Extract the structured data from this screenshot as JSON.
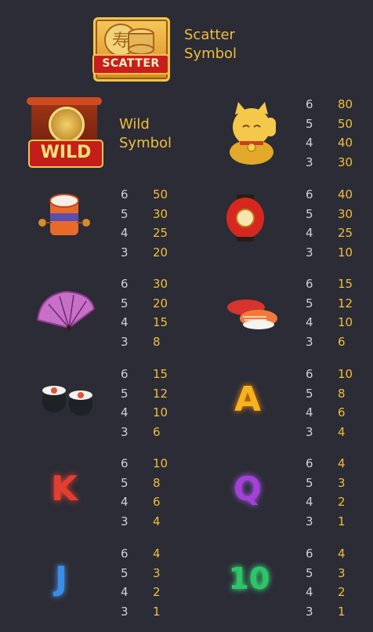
{
  "scatter": {
    "ribbon": "SCATTER",
    "label_line1": "Scatter",
    "label_line2": "Symbol"
  },
  "wild": {
    "ribbon": "WILD",
    "label_line1": "Wild",
    "label_line2": "Symbol"
  },
  "symbols": [
    {
      "icon": "lucky-cat-icon",
      "pays": [
        {
          "count": "6",
          "value": "80"
        },
        {
          "count": "5",
          "value": "50"
        },
        {
          "count": "4",
          "value": "40"
        },
        {
          "count": "3",
          "value": "30"
        }
      ]
    },
    {
      "icon": "drum-icon",
      "pays": [
        {
          "count": "6",
          "value": "50"
        },
        {
          "count": "5",
          "value": "30"
        },
        {
          "count": "4",
          "value": "25"
        },
        {
          "count": "3",
          "value": "20"
        }
      ]
    },
    {
      "icon": "lantern-icon",
      "pays": [
        {
          "count": "6",
          "value": "40"
        },
        {
          "count": "5",
          "value": "30"
        },
        {
          "count": "4",
          "value": "25"
        },
        {
          "count": "3",
          "value": "10"
        }
      ]
    },
    {
      "icon": "fan-icon",
      "pays": [
        {
          "count": "6",
          "value": "30"
        },
        {
          "count": "5",
          "value": "20"
        },
        {
          "count": "4",
          "value": "15"
        },
        {
          "count": "3",
          "value": "8"
        }
      ]
    },
    {
      "icon": "sushi-nigiri-icon",
      "pays": [
        {
          "count": "6",
          "value": "15"
        },
        {
          "count": "5",
          "value": "12"
        },
        {
          "count": "4",
          "value": "10"
        },
        {
          "count": "3",
          "value": "6"
        }
      ]
    },
    {
      "icon": "sushi-roll-icon",
      "pays": [
        {
          "count": "6",
          "value": "15"
        },
        {
          "count": "5",
          "value": "12"
        },
        {
          "count": "4",
          "value": "10"
        },
        {
          "count": "3",
          "value": "6"
        }
      ]
    },
    {
      "icon": "letter-a-icon",
      "pays": [
        {
          "count": "6",
          "value": "10"
        },
        {
          "count": "5",
          "value": "8"
        },
        {
          "count": "4",
          "value": "6"
        },
        {
          "count": "3",
          "value": "4"
        }
      ]
    },
    {
      "icon": "letter-k-icon",
      "pays": [
        {
          "count": "6",
          "value": "10"
        },
        {
          "count": "5",
          "value": "8"
        },
        {
          "count": "4",
          "value": "6"
        },
        {
          "count": "3",
          "value": "4"
        }
      ]
    },
    {
      "icon": "letter-q-icon",
      "pays": [
        {
          "count": "6",
          "value": "4"
        },
        {
          "count": "5",
          "value": "3"
        },
        {
          "count": "4",
          "value": "2"
        },
        {
          "count": "3",
          "value": "1"
        }
      ]
    },
    {
      "icon": "letter-j-icon",
      "pays": [
        {
          "count": "6",
          "value": "4"
        },
        {
          "count": "5",
          "value": "3"
        },
        {
          "count": "4",
          "value": "2"
        },
        {
          "count": "3",
          "value": "1"
        }
      ]
    },
    {
      "icon": "number-10-icon",
      "pays": [
        {
          "count": "6",
          "value": "4"
        },
        {
          "count": "5",
          "value": "3"
        },
        {
          "count": "4",
          "value": "2"
        },
        {
          "count": "3",
          "value": "1"
        }
      ]
    }
  ],
  "letters": {
    "a": "A",
    "k": "K",
    "q": "Q",
    "j": "J",
    "ten": "10"
  },
  "colors": {
    "background": "#2c2c36",
    "gold": "#f0be3c",
    "count": "#d0d0d8"
  }
}
